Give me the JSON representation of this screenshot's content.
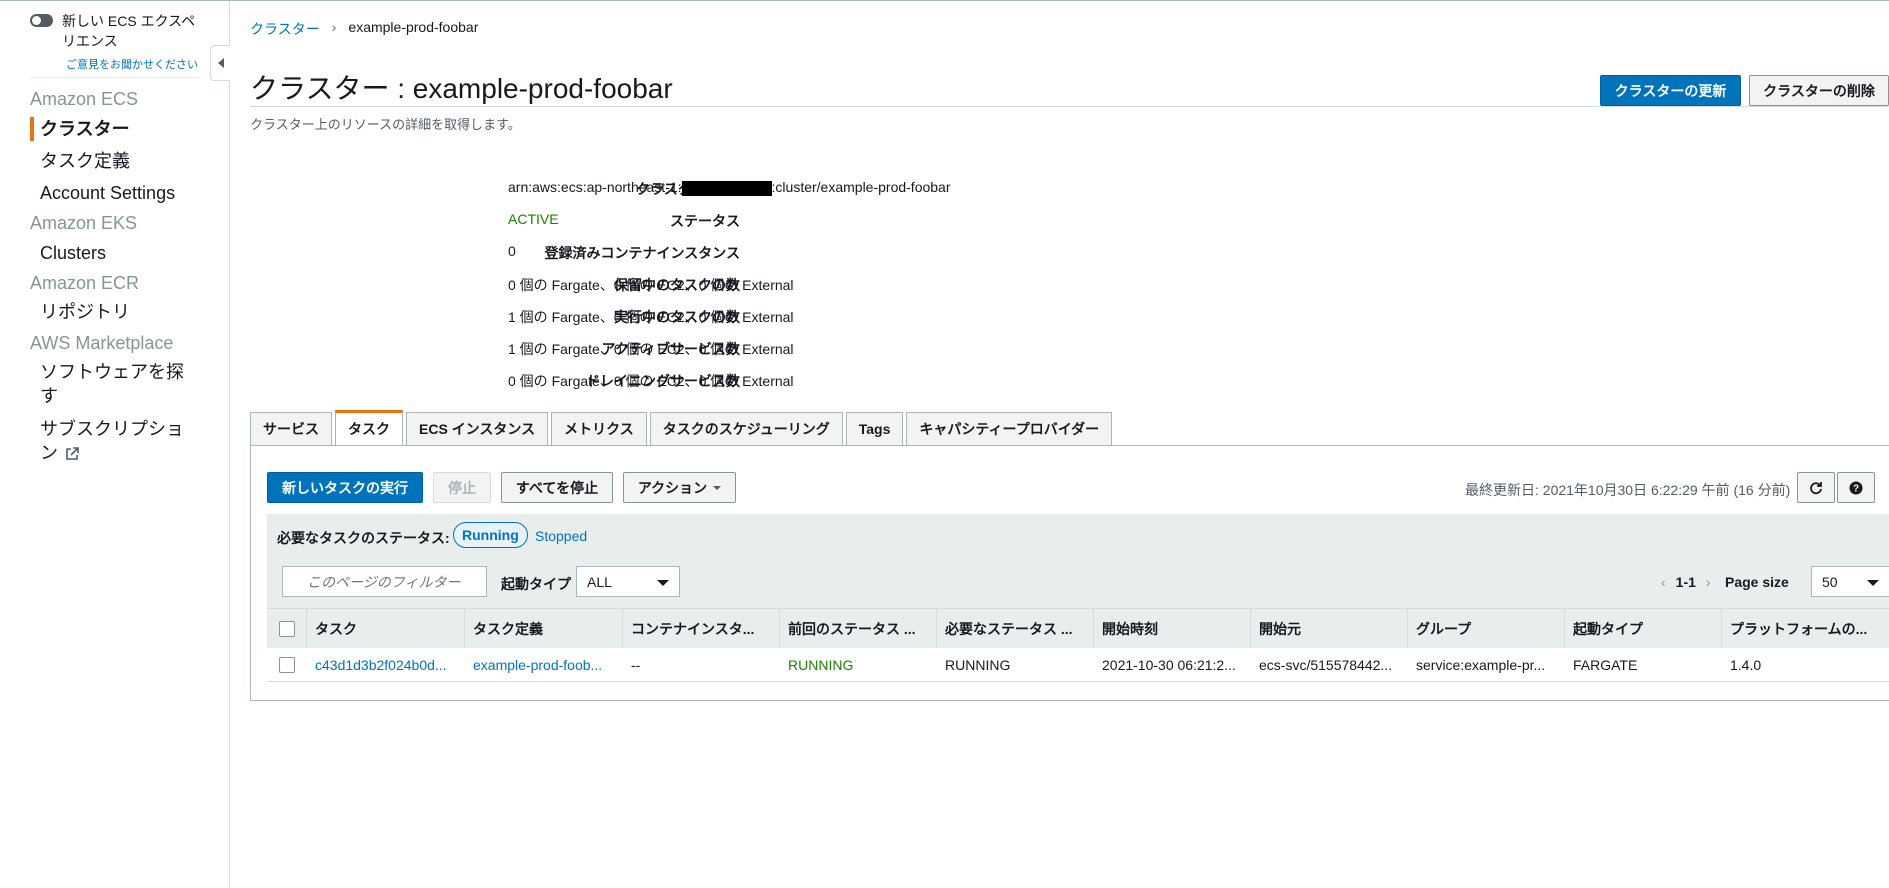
{
  "sidebar": {
    "experience_toggle": "新しい ECS エクスペリエンス",
    "feedback": "ご意見をお聞かせください",
    "sections": [
      {
        "title": "Amazon ECS",
        "items": [
          "クラスター",
          "タスク定義",
          "Account Settings"
        ]
      },
      {
        "title": "Amazon EKS",
        "items": [
          "Clusters"
        ]
      },
      {
        "title": "Amazon ECR",
        "items": [
          "リポジトリ"
        ]
      },
      {
        "title": "AWS Marketplace",
        "items": [
          "ソフトウェアを探す",
          "サブスクリプション"
        ]
      }
    ]
  },
  "breadcrumb": {
    "parent": "クラスター",
    "separator": "›",
    "current": "example-prod-foobar"
  },
  "header": {
    "title": "クラスター : example-prod-foobar",
    "subtitle": "クラスター上のリソースの詳細を取得します。",
    "update_button": "クラスターの更新",
    "delete_button": "クラスターの削除"
  },
  "properties": [
    {
      "label": "クラスター ARN",
      "value_prefix": "arn:aws:ecs:ap-northeast-1:",
      "value_suffix": ":cluster/example-prod-foobar"
    },
    {
      "label": "ステータス",
      "value": "ACTIVE"
    },
    {
      "label": "登録済みコンテナインスタンス",
      "value": "0"
    },
    {
      "label": "保留中のタスクの数",
      "value": "0 個の Fargate、0 個の EC2、0 個の External"
    },
    {
      "label": "実行中のタスクの数",
      "value": "1 個の Fargate、0 個の EC2、0 個の External"
    },
    {
      "label": "アクティブサービス数",
      "value": "1 個の Fargate、0 個の EC2、0 個の External"
    },
    {
      "label": "ドレイニングサービス数",
      "value": "0 個の Fargate、0 個の EC2、0 個の External"
    }
  ],
  "tabs": [
    "サービス",
    "タスク",
    "ECS インスタンス",
    "メトリクス",
    "タスクのスケジューリング",
    "Tags",
    "キャパシティープロバイダー"
  ],
  "active_tab": "タスク",
  "toolbar": {
    "run_task": "新しいタスクの実行",
    "stop": "停止",
    "stop_all": "すべてを停止",
    "actions": "アクション",
    "last_updated": "最終更新日: 2021年10月30日 6:22:29 午前 (16 分前)",
    "refresh_icon": "refresh-icon",
    "help_icon": "help-icon"
  },
  "filters": {
    "desired_status_label": "必要なタスクのステータス:",
    "running": "Running",
    "stopped": "Stopped",
    "filter_placeholder": "このページのフィルター",
    "launch_type_label": "起動タイプ",
    "launch_type_value": "ALL",
    "pagination": "1-1",
    "page_size_label": "Page size",
    "page_size_value": "50"
  },
  "table": {
    "columns": [
      "タスク",
      "タスク定義",
      "コンテナインスタ...",
      "前回のステータス ...",
      "必要なステータス ...",
      "開始時刻",
      "開始元",
      "グループ",
      "起動タイプ",
      "プラットフォームの..."
    ],
    "rows": [
      [
        "c43d1d3b2f024b0d...",
        "example-prod-foob...",
        "--",
        "RUNNING",
        "RUNNING",
        "2021-10-30 06:21:2...",
        "ecs-svc/515578442...",
        "service:example-pr...",
        "FARGATE",
        "1.4.0"
      ]
    ]
  },
  "colors": {
    "accent": "#ec7211",
    "primary": "#0073bb",
    "running_green": "#1d8102"
  }
}
